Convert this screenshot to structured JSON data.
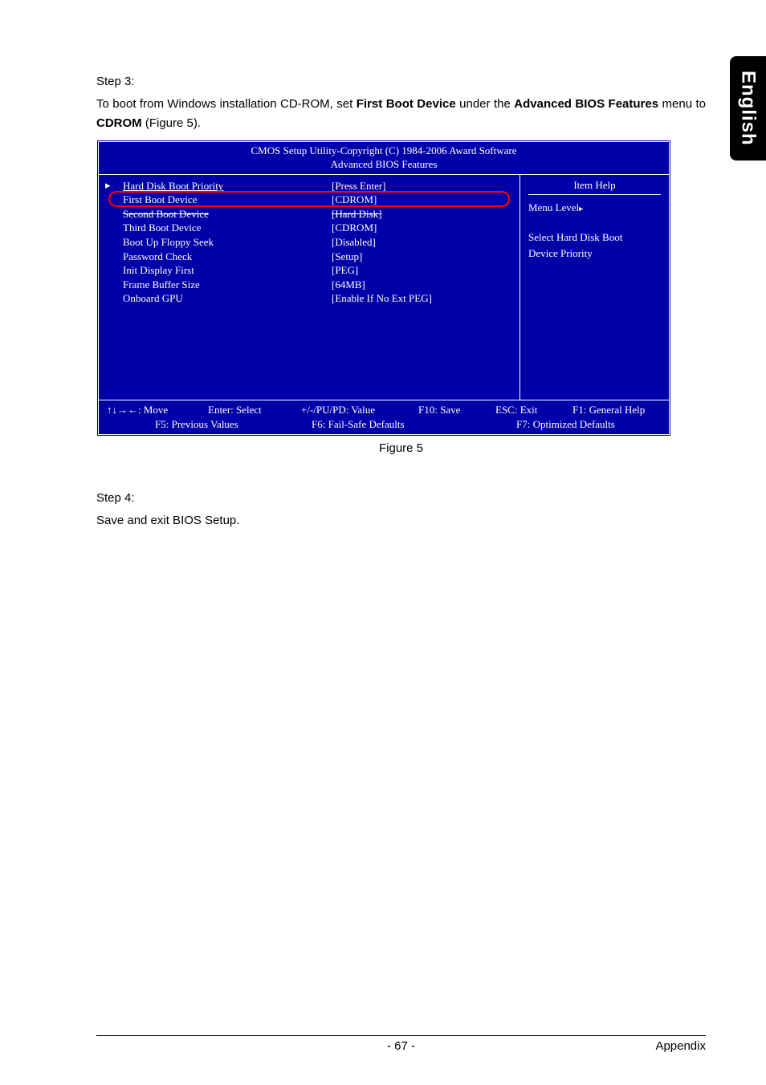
{
  "sideTab": "English",
  "step3Label": "Step 3:",
  "instruction_pre": "To boot from Windows installation CD-ROM, set ",
  "instruction_bold1": "First Boot Device",
  "instruction_mid1": " under the ",
  "instruction_bold2": "Advanced BIOS Features",
  "instruction_mid2": " menu to ",
  "instruction_bold3": "CDROM",
  "instruction_post": "  (Figure 5).",
  "bios": {
    "header1": "CMOS Setup Utility-Copyright (C) 1984-2006 Award Software",
    "header2": "Advanced BIOS Features",
    "rows": [
      {
        "label": "Hard Disk Boot Priority",
        "value": "[Press Enter]"
      },
      {
        "label": "First Boot Device",
        "value": "[CDROM]"
      },
      {
        "label": "Second Boot Device",
        "value": "[Hard Disk]"
      },
      {
        "label": "Third Boot Device",
        "value": "[CDROM]"
      },
      {
        "label": "Boot Up Floppy Seek",
        "value": "[Disabled]"
      },
      {
        "label": "Password Check",
        "value": "[Setup]"
      },
      {
        "label": "Init Display First",
        "value": "[PEG]"
      },
      {
        "label": "Frame Buffer Size",
        "value": "[64MB]"
      },
      {
        "label": "Onboard GPU",
        "value": "[Enable If No Ext PEG]"
      }
    ],
    "helpTitle": "Item Help",
    "menuLevel": "Menu Level",
    "helpLine1": "Select Hard Disk Boot",
    "helpLine2": "Device Priority",
    "footer1_a": "↑↓→←: Move",
    "footer1_b": "Enter: Select",
    "footer1_c": "+/-/PU/PD: Value",
    "footer1_d": "F10: Save",
    "footer1_e": "ESC: Exit",
    "footer1_f": "F1: General Help",
    "footer2_a": "F5: Previous Values",
    "footer2_b": "F6: Fail-Safe Defaults",
    "footer2_c": "F7: Optimized Defaults"
  },
  "figureCaption": "Figure 5",
  "step4Label": "Step 4:",
  "step4Text": "Save and exit BIOS Setup.",
  "pageNum": "- 67 -",
  "appendix": "Appendix"
}
